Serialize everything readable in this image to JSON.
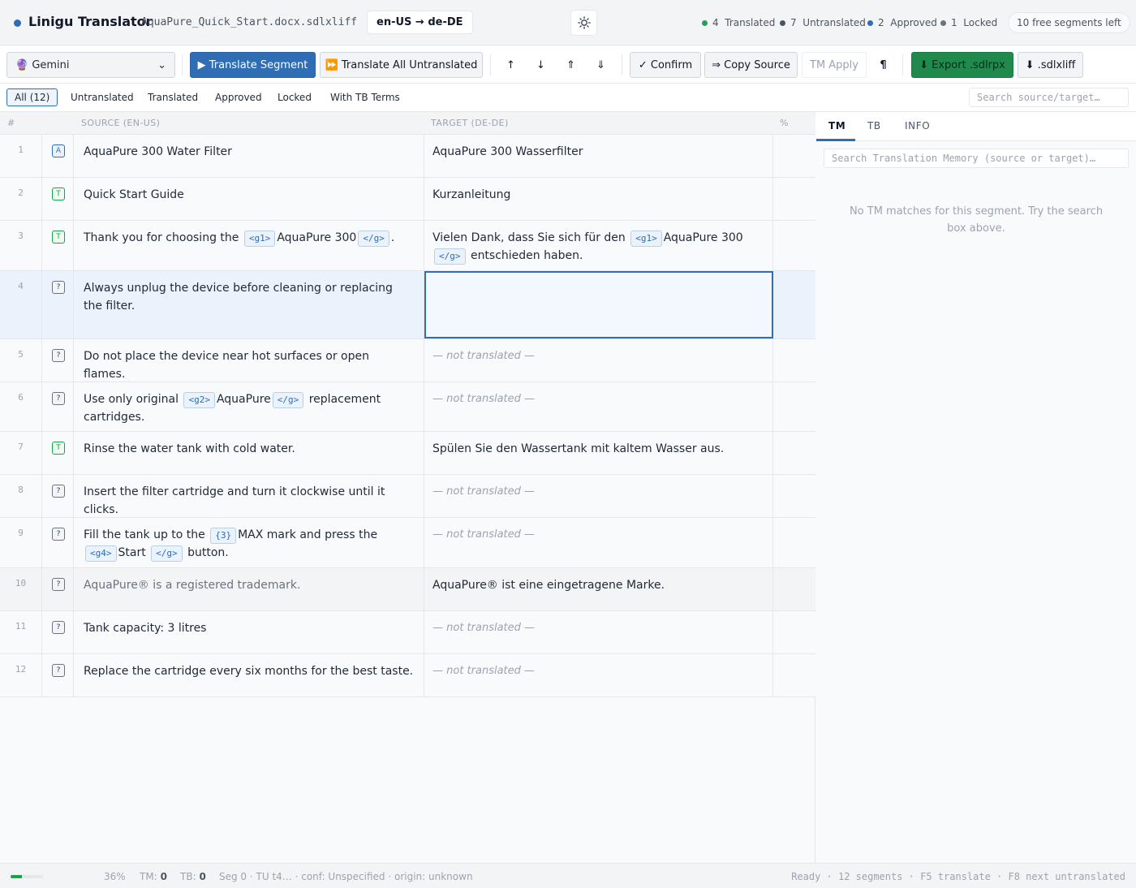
{
  "header": {
    "app_title": "Linigu Translator",
    "file_name": "AquaPure_Quick_Start.docx.sdlxliff",
    "lang_pair": "en-US → de-DE",
    "stats": [
      {
        "count": "4",
        "label": "Translated",
        "color": "#22a05a"
      },
      {
        "count": "7",
        "label": "Untranslated",
        "color": "#4b5563"
      },
      {
        "count": "2",
        "label": "Approved",
        "color": "#2f6db5"
      },
      {
        "count": "1",
        "label": "Locked",
        "color": "#6b7280"
      }
    ],
    "free_segments": "10 free segments left"
  },
  "toolbar": {
    "engine": "🔮 Gemini",
    "translate_segment": "▶ Translate Segment",
    "translate_all": "⏩ Translate All Untranslated",
    "nav_prev": "↑",
    "nav_next": "↓",
    "nav_first": "⇑",
    "nav_last": "⇓",
    "confirm": "✓ Confirm",
    "copy_source": "⇒ Copy Source",
    "tm_apply": "TM Apply",
    "pilcrow": "¶",
    "export_sdlrpx": "⬇ Export .sdlrpx",
    "export_sdlxliff": "⬇ .sdlxliff"
  },
  "filters": {
    "items": [
      "All (12)",
      "Untranslated",
      "Translated",
      "Approved",
      "Locked",
      "With TB Terms"
    ],
    "search_placeholder": "Search source/target…"
  },
  "grid": {
    "col_num": "#",
    "col_source": "SOURCE (EN-US)",
    "col_target": "TARGET (DE-DE)",
    "col_pct": "%",
    "not_translated": "— not translated —",
    "rows": [
      {
        "num": "1",
        "status": "A",
        "source": [
          "AquaPure 300 Water Filter"
        ],
        "target": [
          "AquaPure 300 Wasserfilter"
        ]
      },
      {
        "num": "2",
        "status": "T",
        "source": [
          "Quick Start Guide"
        ],
        "target": [
          "Kurzanleitung"
        ]
      },
      {
        "num": "3",
        "status": "T",
        "source": [
          "Thank you for choosing the ",
          {
            "tag": "<g1>"
          },
          "AquaPure 300",
          {
            "tag": "</g>"
          },
          "."
        ],
        "target": [
          "Vielen Dank, dass Sie sich für den ",
          {
            "tag": "<g1>"
          },
          "AquaPure 300",
          {
            "tag": "</g>"
          },
          " entschieden haben."
        ]
      },
      {
        "num": "4",
        "status": "?",
        "source": [
          "Always unplug the device before cleaning or replacing the filter."
        ],
        "target": "",
        "selected": true
      },
      {
        "num": "5",
        "status": "?",
        "source": [
          "Do not place the device near hot surfaces or open flames."
        ],
        "target": null
      },
      {
        "num": "6",
        "status": "?",
        "source": [
          "Use only original ",
          {
            "tag": "<g2>"
          },
          "AquaPure",
          {
            "tag": "</g>"
          },
          " replacement cartridges."
        ],
        "target": null
      },
      {
        "num": "7",
        "status": "T",
        "source": [
          "Rinse the water tank with cold water."
        ],
        "target": [
          "Spülen Sie den Wassertank mit kaltem Wasser aus."
        ]
      },
      {
        "num": "8",
        "status": "?",
        "source": [
          "Insert the filter cartridge and turn it clockwise until it clicks."
        ],
        "target": null
      },
      {
        "num": "9",
        "status": "?",
        "source": [
          "Fill the tank up to the ",
          {
            "tag": "{3}"
          },
          "MAX mark and press the ",
          {
            "tag": "<g4>"
          },
          "Start ",
          {
            "tag": "</g>"
          },
          " button."
        ],
        "target": null
      },
      {
        "num": "10",
        "status": "?",
        "source": [
          "AquaPure® is a registered trademark."
        ],
        "target": [
          "AquaPure® ist eine eingetragene Marke."
        ],
        "locked": true
      },
      {
        "num": "11",
        "status": "?",
        "source": [
          "Tank capacity: 3 litres"
        ],
        "target": null
      },
      {
        "num": "12",
        "status": "?",
        "source": [
          "Replace the cartridge every six months for the best taste."
        ],
        "target": null
      }
    ]
  },
  "panel": {
    "tabs": [
      "TM",
      "TB",
      "INFO"
    ],
    "search_placeholder": "Search Translation Memory (source or target)…",
    "empty_message": "No TM matches for this segment. Try the search box above."
  },
  "statusbar": {
    "progress_percent": 36,
    "percent_label": "36%",
    "tm_label": "TM:",
    "tm_value": "0",
    "tb_label": "TB:",
    "tb_value": "0",
    "seg_info": "Seg 0 · TU t4… · conf: Unspecified · origin: unknown",
    "right_text": "Ready · 12 segments · F5 translate · F8 next untranslated"
  },
  "colors": {
    "accent": "#2f6db5",
    "export": "#1f8a4c",
    "translated": "#22a05a"
  }
}
